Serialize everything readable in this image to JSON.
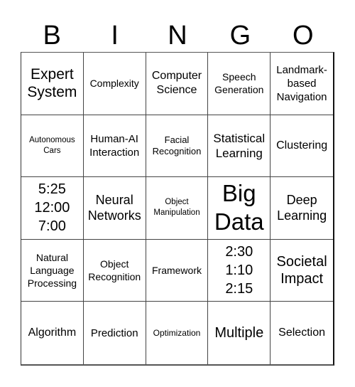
{
  "header": {
    "letters": [
      "B",
      "I",
      "N",
      "G",
      "O"
    ]
  },
  "cells": [
    {
      "text": "Expert\nSystem"
    },
    {
      "text": "Complexity"
    },
    {
      "text": "Computer\nScience"
    },
    {
      "text": "Speech\nGeneration"
    },
    {
      "text": "Landmark-\nbased\nNavigation"
    },
    {
      "text": "Autonomous\nCars"
    },
    {
      "text": "Human-AI\nInteraction"
    },
    {
      "text": "Facial\nRecognition"
    },
    {
      "text": "Statistical\nLearning"
    },
    {
      "text": "Clustering"
    },
    {
      "text": "5:25\n12:00\n7:00"
    },
    {
      "text": "Neural\nNetworks"
    },
    {
      "text": "Object\nManipulation"
    },
    {
      "text": "Big\nData"
    },
    {
      "text": "Deep\nLearning"
    },
    {
      "text": "Natural\nLanguage\nProcessing"
    },
    {
      "text": "Object\nRecognition"
    },
    {
      "text": "Framework"
    },
    {
      "text": "2:30\n1:10\n2:15"
    },
    {
      "text": "Societal\nImpact"
    },
    {
      "text": "Algorithm"
    },
    {
      "text": "Prediction"
    },
    {
      "text": "Optimization"
    },
    {
      "text": "Multiple"
    },
    {
      "text": "Selection"
    }
  ]
}
